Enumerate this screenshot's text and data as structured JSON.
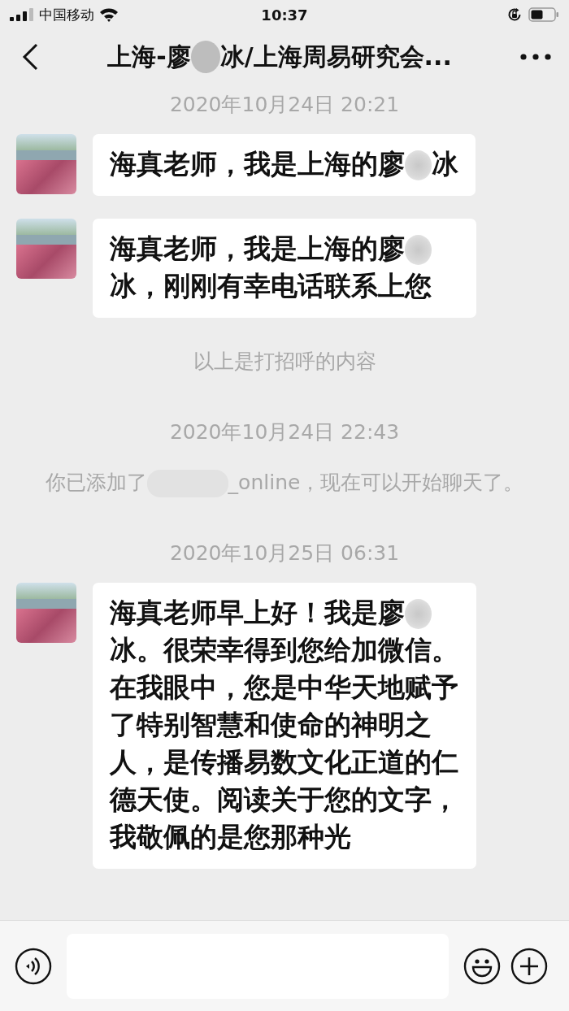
{
  "status_bar": {
    "carrier": "中国移动",
    "time": "10:37"
  },
  "nav": {
    "title_parts": [
      {
        "kind": "text",
        "text": "上海-廖"
      },
      {
        "kind": "blur"
      },
      {
        "kind": "text",
        "text": "冰/上海周易研究会..."
      }
    ]
  },
  "chat": [
    {
      "kind": "time",
      "text": "2020年10月24日 20:21"
    },
    {
      "kind": "message",
      "parts": [
        {
          "kind": "text",
          "text": "海真老师，我是上海的廖"
        },
        {
          "kind": "blur"
        },
        {
          "kind": "text",
          "text": "冰"
        }
      ]
    },
    {
      "kind": "message",
      "parts": [
        {
          "kind": "text",
          "text": "海真老师，我是上海的廖"
        },
        {
          "kind": "blur"
        },
        {
          "kind": "text",
          "text": "冰，刚刚有幸电话联系上您"
        }
      ]
    },
    {
      "kind": "notice",
      "parts": [
        {
          "kind": "text",
          "text": "以上是打招呼的内容"
        }
      ]
    },
    {
      "kind": "time",
      "text": "2020年10月24日 22:43"
    },
    {
      "kind": "notice",
      "parts": [
        {
          "kind": "text",
          "text": "你已添加了"
        },
        {
          "kind": "wideblur"
        },
        {
          "kind": "text",
          "text": "_online，现在可以开始聊天了。"
        }
      ]
    },
    {
      "kind": "time",
      "text": "2020年10月25日 06:31"
    },
    {
      "kind": "message",
      "parts": [
        {
          "kind": "text",
          "text": "海真老师早上好！我是廖"
        },
        {
          "kind": "blur"
        },
        {
          "kind": "text",
          "text": "冰。很荣幸得到您给加微信。在我眼中，您是中华天地赋予了特别智慧和使命的神明之人，是传播易数文化正道的仁德天使。阅读关于您的文字，我敬佩的是您那种光"
        }
      ]
    }
  ]
}
